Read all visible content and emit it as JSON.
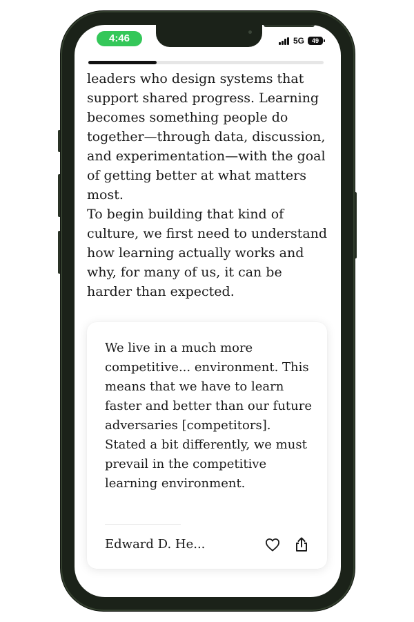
{
  "status_bar": {
    "time": "4:46",
    "network": "5G",
    "battery": "49"
  },
  "reading_progress": {
    "fraction": 0.29
  },
  "article": {
    "paragraph_1": "leaders who design systems that support shared progress. Learning becomes something people do together—through data, discussion, and experimentation—with the goal of getting better at what matters most.",
    "paragraph_2": "To begin building that kind of culture, we first need to understand how learning actually works and why, for many of us, it can be harder than expected."
  },
  "quote_card": {
    "text": "We live in a much more competitive... environment. This means that we have to learn faster and better than our future adversaries [competitors]. Stated a bit differently, we must prevail in the competitive learning environment.",
    "author": "Edward D. He...",
    "like_icon": "heart-icon",
    "share_icon": "share-icon"
  },
  "colors": {
    "time_pill": "#34c759",
    "frame": "#1b2219",
    "text": "#1a1a1a",
    "progress_fill": "#111111",
    "progress_track": "#e6e6e6"
  }
}
